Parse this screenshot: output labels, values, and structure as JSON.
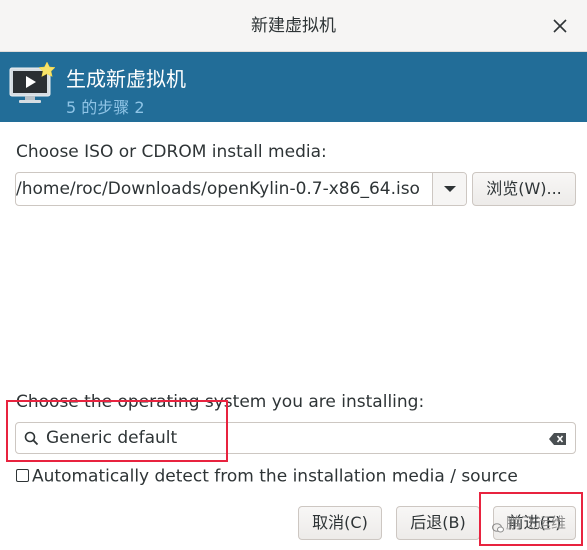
{
  "window": {
    "title": "新建虚拟机",
    "close_icon": "close-icon"
  },
  "header": {
    "title": "生成新虚拟机",
    "step": "5 的步骤 2",
    "icon": "vm-monitor-icon",
    "colors": {
      "background": "#226d98",
      "subtitle": "#8fc4e6"
    }
  },
  "media": {
    "label": "Choose ISO or CDROM install media:",
    "path_value": "/home/roc/Downloads/openKylin-0.7-x86_64.iso",
    "browse_label": "浏览(W)..."
  },
  "os": {
    "label": "Choose the operating system you are installing:",
    "search_value": "Generic default",
    "autodetect_label": "Automatically detect from the installation media / source",
    "autodetect_checked": false
  },
  "buttons": {
    "cancel": "取消(C)",
    "back": "后退(B)",
    "forward": "前进(F)"
  },
  "annotations": {
    "highlight_color": "#e8233f",
    "watermark": "鹏飞运维"
  }
}
